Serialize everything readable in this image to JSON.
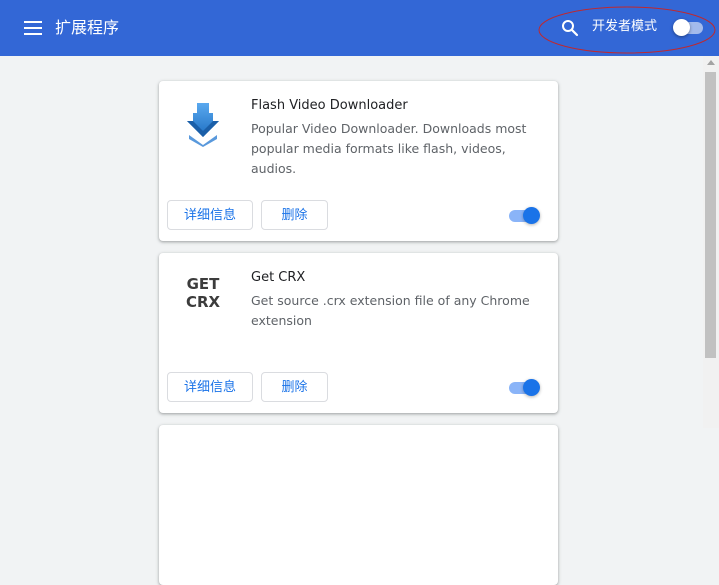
{
  "header": {
    "menu_icon": "hamburger-menu-icon",
    "title": "扩展程序",
    "search_icon": "search-icon",
    "dev_mode_label": "开发者模式",
    "dev_mode_enabled": false
  },
  "extensions": [
    {
      "name": "Flash Video Downloader",
      "description": "Popular Video Downloader. Downloads most popular media formats like flash, videos, audios.",
      "icon": "download-arrow-icon",
      "details_label": "详细信息",
      "remove_label": "删除",
      "enabled": true
    },
    {
      "name": "Get CRX",
      "description": "Get source .crx extension file of any Chrome extension",
      "icon_text_line1": "GET",
      "icon_text_line2": "CRX",
      "details_label": "详细信息",
      "remove_label": "删除",
      "enabled": true
    }
  ],
  "colors": {
    "header_bg": "#3367d6",
    "accent": "#1a73e8",
    "annotation": "#c0282e"
  }
}
